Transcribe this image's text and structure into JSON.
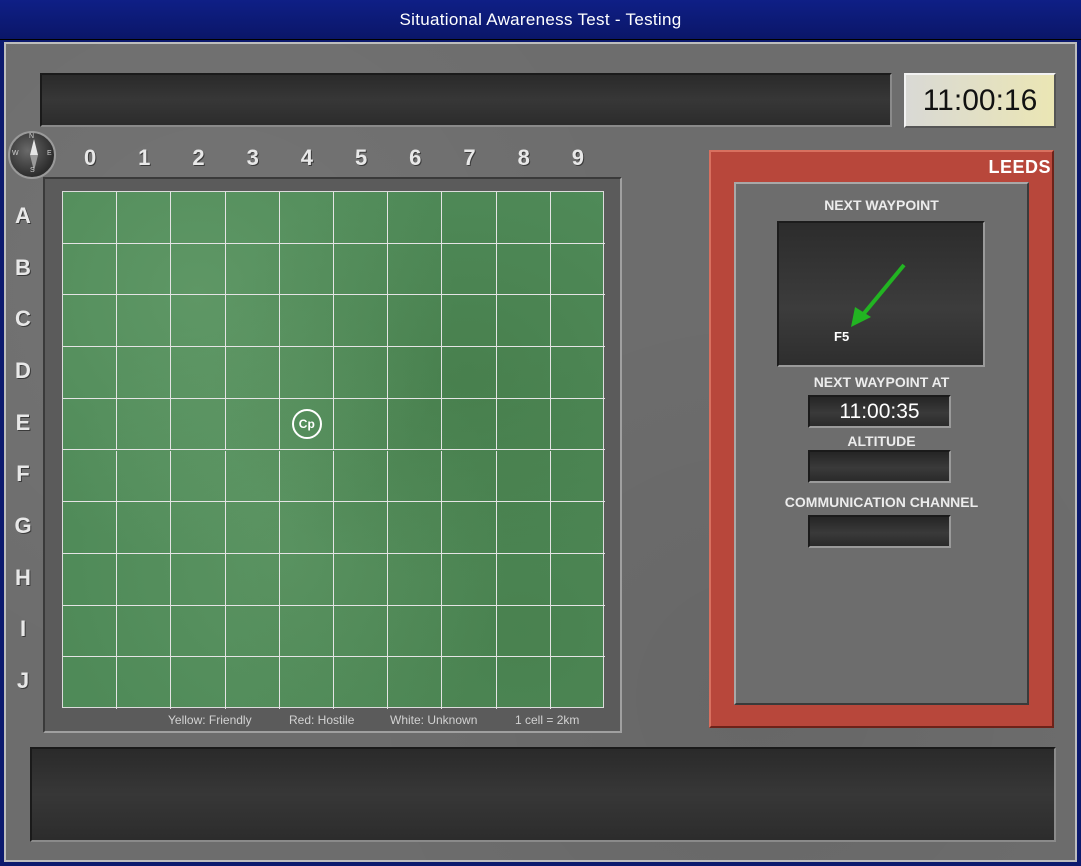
{
  "window": {
    "title": "Situational Awareness Test  -  Testing"
  },
  "clock": {
    "time": "11:00:16"
  },
  "compass": {
    "n": "N",
    "s": "S",
    "e": "E",
    "w": "W"
  },
  "grid": {
    "columns": [
      "0",
      "1",
      "2",
      "3",
      "4",
      "5",
      "6",
      "7",
      "8",
      "9"
    ],
    "rows": [
      "A",
      "B",
      "C",
      "D",
      "E",
      "F",
      "G",
      "H",
      "I",
      "J"
    ],
    "markers": [
      {
        "label": "Cp",
        "row": "E",
        "column": "4",
        "color": "#ffffff"
      }
    ]
  },
  "legend": {
    "friendly": "Yellow:  Friendly",
    "hostile": "Red:  Hostile",
    "unknown": "White:  Unknown",
    "scale": "1  cell  =  2km"
  },
  "side_panel": {
    "callsign": "LEEDS",
    "next_waypoint_label": "NEXT WAYPOINT",
    "waypoint_code": "F5",
    "arrow_color": "#22b422",
    "next_waypoint_at_label": "NEXT WAYPOINT AT",
    "next_waypoint_time": "11:00:35",
    "altitude_label": "ALTITUDE",
    "altitude_value": "",
    "comm_channel_label": "COMMUNICATION  CHANNEL",
    "comm_channel_value": ""
  },
  "messages": {
    "top": "",
    "bottom": ""
  },
  "colors": {
    "title_bar": "#0f1f86",
    "map_green": "#4f8a58",
    "panel_red": "#b8473b"
  }
}
